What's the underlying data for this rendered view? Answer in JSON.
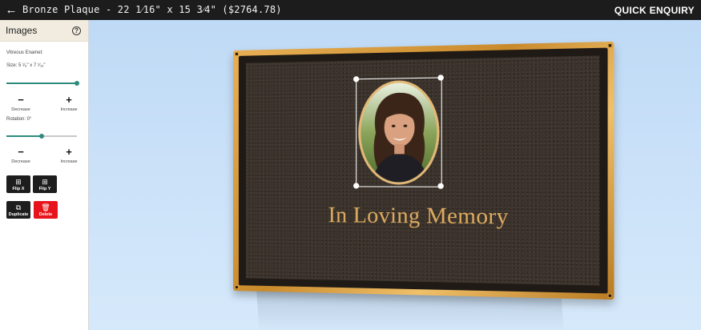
{
  "topbar": {
    "back_icon": "arrow-left-icon",
    "title": "Bronze Plaque - 22 1⁄16\" x 15 3⁄4\" ($2764.78)",
    "enquiry_label": "QUICK ENQUIRY"
  },
  "sidebar": {
    "heading": "Images",
    "help_icon": "help-circle-icon",
    "material": "Vitreous Enamel:",
    "size_label": "Size: 5 ¹⁄₈\" x 7 ¹⁄₁₆\"",
    "size_value": 1.0,
    "rotation_label": "Rotation: 0°",
    "rotation_value": 0.5,
    "decrease_label": "Decrease",
    "increase_label": "Increase",
    "decrease_symbol": "−",
    "increase_symbol": "+",
    "buttons": {
      "flip_x": "Flip X",
      "flip_y": "Flip Y",
      "duplicate": "Duplicate",
      "delete": "Delete"
    },
    "accent_color": "#2e8b7d",
    "delete_color": "#e8141b"
  },
  "plaque": {
    "text": "In Loving Memory",
    "text_color": "#e0ad60",
    "border_color": "#d99b3b"
  }
}
